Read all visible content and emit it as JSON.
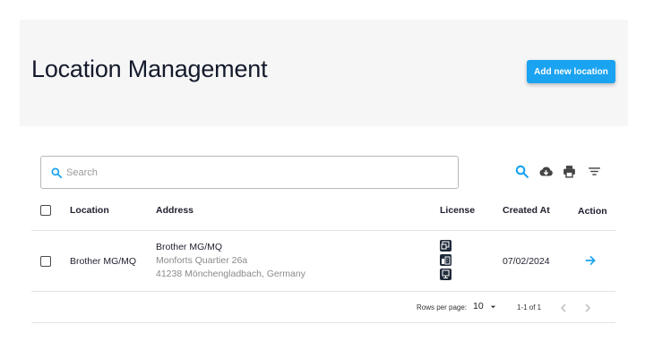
{
  "header": {
    "title": "Location Management",
    "add_button_label": "Add new location"
  },
  "search": {
    "placeholder": "Search",
    "value": ""
  },
  "toolbar": {
    "icons": [
      "search-icon",
      "cloud-download-icon",
      "print-icon",
      "filter-icon"
    ]
  },
  "table": {
    "columns": [
      "Location",
      "Address",
      "License",
      "Created At",
      "Action"
    ],
    "rows": [
      {
        "location": "Brother MG/MQ",
        "address_line1": "Brother MG/MQ",
        "address_line2": "Monforts Quartier 26a",
        "address_line3": "41238 Mönchengladbach, Germany",
        "licenses": [
          "copy-license-icon",
          "building-license-icon",
          "display-license-icon"
        ],
        "created_at": "07/02/2024"
      }
    ]
  },
  "pagination": {
    "rows_per_page_label": "Rows per page:",
    "rows_per_page_value": "10",
    "range": "1-1 of 1"
  },
  "colors": {
    "accent": "#1aa3f0",
    "header_bg": "#f6f6f7",
    "title": "#141a2b"
  }
}
